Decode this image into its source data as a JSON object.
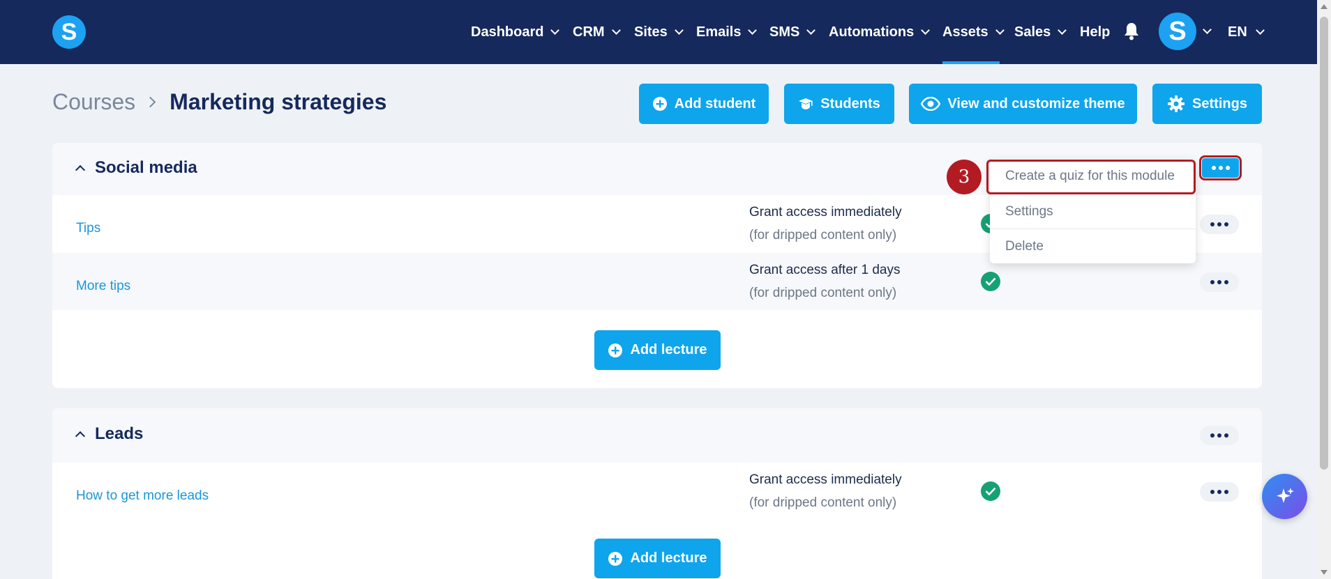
{
  "nav": {
    "items": [
      {
        "label": "Dashboard",
        "has_dropdown": true
      },
      {
        "label": "CRM",
        "has_dropdown": true
      },
      {
        "label": "Sites",
        "has_dropdown": true
      },
      {
        "label": "Emails",
        "has_dropdown": true
      },
      {
        "label": "SMS",
        "has_dropdown": true
      },
      {
        "label": "Automations",
        "has_dropdown": true
      },
      {
        "label": "Assets",
        "has_dropdown": true,
        "active": true
      },
      {
        "label": "Sales",
        "has_dropdown": true
      },
      {
        "label": "Help",
        "has_dropdown": false
      }
    ],
    "logo_letter": "S",
    "avatar_letter": "S",
    "language": "EN",
    "colors": {
      "bar": "#15295c",
      "accent": "#1da1f2"
    }
  },
  "breadcrumb": {
    "parent": "Courses",
    "current": "Marketing strategies"
  },
  "toolbar": {
    "add_student": "Add student",
    "students": "Students",
    "view_theme": "View and customize theme",
    "settings": "Settings"
  },
  "modules": [
    {
      "title": "Social media",
      "lectures": [
        {
          "title": "Tips",
          "access": "Grant access immediately",
          "access_note": "(for dripped content only)",
          "status": "check-icon"
        },
        {
          "title": "More tips",
          "access": "Grant access after 1 days",
          "access_note": "(for dripped content only)",
          "status": "check-icon"
        }
      ],
      "add_lecture": "Add lecture"
    },
    {
      "title": "Leads",
      "lectures": [
        {
          "title": "How to get more leads",
          "access": "Grant access immediately",
          "access_note": "(for dripped content only)",
          "status": "check-icon"
        }
      ],
      "add_lecture": "Add lecture"
    }
  ],
  "dropdown": {
    "items": [
      {
        "label": "Create a quiz for this module"
      },
      {
        "label": "Settings"
      },
      {
        "label": "Delete"
      }
    ]
  },
  "annotation": {
    "step": "3",
    "color": "#b31b22"
  }
}
